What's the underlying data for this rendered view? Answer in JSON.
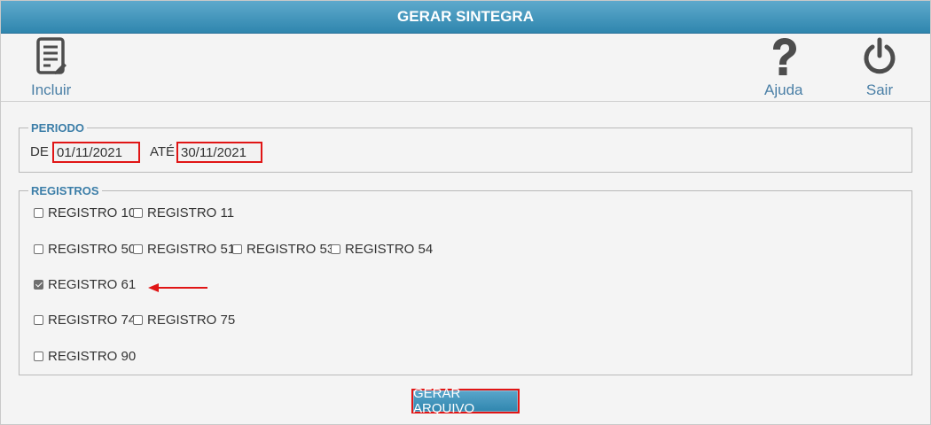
{
  "window": {
    "title": "GERAR SINTEGRA"
  },
  "toolbar": {
    "incluir_label": "Incluir",
    "ajuda_label": "Ajuda",
    "sair_label": "Sair"
  },
  "periodo": {
    "legend": "PERIODO",
    "de_label": "DE",
    "de_value": "01/11/2021",
    "ate_label": "ATÉ",
    "ate_value": "30/11/2021"
  },
  "registros": {
    "legend": "REGISTROS",
    "items": [
      {
        "label": "REGISTRO 10",
        "checked": false
      },
      {
        "label": "REGISTRO 11",
        "checked": false
      },
      {
        "label": "REGISTRO 50",
        "checked": false
      },
      {
        "label": "REGISTRO 51",
        "checked": false
      },
      {
        "label": "REGISTRO 53",
        "checked": false
      },
      {
        "label": "REGISTRO 54",
        "checked": false
      },
      {
        "label": "REGISTRO 61",
        "checked": true
      },
      {
        "label": "REGISTRO 74",
        "checked": false
      },
      {
        "label": "REGISTRO 75",
        "checked": false
      },
      {
        "label": "REGISTRO 90",
        "checked": false
      }
    ]
  },
  "actions": {
    "gerar_label": "GERAR ARQUIVO"
  },
  "colors": {
    "accent": "#2f86ae",
    "highlight": "#e01515",
    "label": "#4a7fa6"
  },
  "icons": [
    "document-edit-icon",
    "question-mark-icon",
    "power-icon",
    "arrow-left-icon"
  ]
}
